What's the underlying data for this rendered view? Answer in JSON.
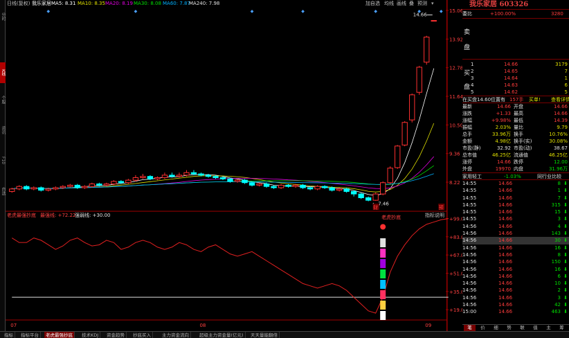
{
  "left_tabs": [
    "分时",
    "K线",
    "个股",
    "资讯",
    "F10",
    "自选"
  ],
  "main_header": {
    "period": "日线(复权)",
    "stock_name": "我乐家居",
    "ma": [
      {
        "label": "MA5: 8.31",
        "color": "#ffffff"
      },
      {
        "label": "MA10: 8.35",
        "color": "#e0e000"
      },
      {
        "label": "MA20: 8.19",
        "color": "#e000e0"
      },
      {
        "label": "MA30: 8.08",
        "color": "#00e000"
      },
      {
        "label": "MA60: 7.87",
        "color": "#00b0ff"
      },
      {
        "label": "MA240: 7.98",
        "color": "#e0e0e0"
      }
    ],
    "buttons": [
      "加自选",
      "均线",
      "画线",
      "叠",
      "预测"
    ]
  },
  "price_axis": [
    "15.06",
    "13.92",
    "12.78",
    "11.64",
    "10.50",
    "9.36",
    "8.22"
  ],
  "price_notes": {
    "high": "14.66",
    "low": "7.46"
  },
  "markers": [
    "财",
    "预"
  ],
  "sub_header": {
    "name": "老虎最强抄底",
    "value1": "最强线: +72.22",
    "value2": "强弱线: +30.00",
    "help": "指标说明"
  },
  "sub_axis": [
    "+99.09",
    "+83.08",
    "+67.07",
    "+51.05",
    "+35.03",
    "+19.02"
  ],
  "sub_annotation": "老虎抄底",
  "months": [
    "07",
    "08",
    "09"
  ],
  "chart_data": [
    {
      "type": "candlestick",
      "title": "我乐家居 日线(复权)",
      "ylim": [
        7.2,
        15.2
      ],
      "candles": [
        {
          "o": 7.85,
          "c": 7.95,
          "h": 8.0,
          "l": 7.8
        },
        {
          "o": 7.95,
          "c": 8.05,
          "h": 8.1,
          "l": 7.9
        },
        {
          "o": 8.05,
          "c": 7.95,
          "h": 8.1,
          "l": 7.9
        },
        {
          "o": 7.95,
          "c": 8.0,
          "h": 8.05,
          "l": 7.9
        },
        {
          "o": 8.0,
          "c": 7.9,
          "h": 8.05,
          "l": 7.85
        },
        {
          "o": 7.9,
          "c": 7.95,
          "h": 8.0,
          "l": 7.85
        },
        {
          "o": 7.95,
          "c": 8.0,
          "h": 8.05,
          "l": 7.9
        },
        {
          "o": 8.0,
          "c": 8.05,
          "h": 8.1,
          "l": 7.95
        },
        {
          "o": 8.05,
          "c": 8.1,
          "h": 8.15,
          "l": 8.0
        },
        {
          "o": 8.1,
          "c": 8.0,
          "h": 8.15,
          "l": 7.95
        },
        {
          "o": 8.0,
          "c": 8.05,
          "h": 8.1,
          "l": 7.95
        },
        {
          "o": 8.05,
          "c": 8.15,
          "h": 8.2,
          "l": 8.0
        },
        {
          "o": 8.15,
          "c": 8.1,
          "h": 8.2,
          "l": 8.05
        },
        {
          "o": 8.1,
          "c": 8.15,
          "h": 8.2,
          "l": 8.05
        },
        {
          "o": 8.15,
          "c": 8.25,
          "h": 8.3,
          "l": 8.1
        },
        {
          "o": 8.25,
          "c": 8.2,
          "h": 8.3,
          "l": 8.15
        },
        {
          "o": 8.2,
          "c": 8.3,
          "h": 8.35,
          "l": 8.15
        },
        {
          "o": 8.3,
          "c": 8.4,
          "h": 8.5,
          "l": 8.25
        },
        {
          "o": 8.4,
          "c": 8.45,
          "h": 8.55,
          "l": 8.35
        },
        {
          "o": 8.45,
          "c": 8.35,
          "h": 8.5,
          "l": 8.3
        },
        {
          "o": 8.35,
          "c": 8.4,
          "h": 8.45,
          "l": 8.3
        },
        {
          "o": 8.4,
          "c": 8.5,
          "h": 8.6,
          "l": 8.35
        },
        {
          "o": 8.5,
          "c": 8.45,
          "h": 8.6,
          "l": 8.4
        },
        {
          "o": 8.45,
          "c": 8.5,
          "h": 8.6,
          "l": 8.4
        },
        {
          "o": 8.5,
          "c": 8.6,
          "h": 8.7,
          "l": 8.45
        },
        {
          "o": 8.6,
          "c": 8.55,
          "h": 8.7,
          "l": 8.5
        },
        {
          "o": 8.55,
          "c": 8.5,
          "h": 8.6,
          "l": 8.45
        },
        {
          "o": 8.5,
          "c": 8.45,
          "h": 8.55,
          "l": 8.4
        },
        {
          "o": 8.45,
          "c": 8.4,
          "h": 8.5,
          "l": 8.35
        },
        {
          "o": 8.4,
          "c": 8.35,
          "h": 8.45,
          "l": 8.3
        },
        {
          "o": 8.35,
          "c": 8.25,
          "h": 8.4,
          "l": 8.2
        },
        {
          "o": 8.25,
          "c": 8.3,
          "h": 8.35,
          "l": 8.2
        },
        {
          "o": 8.3,
          "c": 8.2,
          "h": 8.35,
          "l": 8.15
        },
        {
          "o": 8.2,
          "c": 8.1,
          "h": 8.25,
          "l": 8.05
        },
        {
          "o": 8.1,
          "c": 8.15,
          "h": 8.2,
          "l": 8.05
        },
        {
          "o": 8.15,
          "c": 8.05,
          "h": 8.2,
          "l": 8.0
        },
        {
          "o": 8.05,
          "c": 8.0,
          "h": 8.1,
          "l": 7.95
        },
        {
          "o": 8.0,
          "c": 8.1,
          "h": 8.15,
          "l": 7.95
        },
        {
          "o": 8.1,
          "c": 8.05,
          "h": 8.15,
          "l": 8.0
        },
        {
          "o": 8.05,
          "c": 8.1,
          "h": 8.15,
          "l": 8.0
        },
        {
          "o": 8.1,
          "c": 8.0,
          "h": 8.15,
          "l": 7.95
        },
        {
          "o": 8.0,
          "c": 7.95,
          "h": 8.05,
          "l": 7.9
        },
        {
          "o": 7.95,
          "c": 8.05,
          "h": 8.1,
          "l": 7.9
        },
        {
          "o": 8.05,
          "c": 8.0,
          "h": 8.1,
          "l": 7.95
        },
        {
          "o": 8.0,
          "c": 7.9,
          "h": 8.05,
          "l": 7.85
        },
        {
          "o": 7.9,
          "c": 7.95,
          "h": 8.0,
          "l": 7.85
        },
        {
          "o": 7.95,
          "c": 7.85,
          "h": 8.0,
          "l": 7.8
        },
        {
          "o": 7.85,
          "c": 7.75,
          "h": 7.9,
          "l": 7.65
        },
        {
          "o": 7.75,
          "c": 7.6,
          "h": 7.8,
          "l": 7.55
        },
        {
          "o": 7.6,
          "c": 7.5,
          "h": 7.65,
          "l": 7.46
        },
        {
          "o": 7.5,
          "c": 7.75,
          "h": 7.8,
          "l": 7.48
        },
        {
          "o": 7.75,
          "c": 8.2,
          "h": 8.25,
          "l": 7.7
        },
        {
          "o": 8.2,
          "c": 8.78,
          "h": 8.85,
          "l": 8.15
        },
        {
          "o": 8.8,
          "c": 9.66,
          "h": 9.7,
          "l": 8.75
        },
        {
          "o": 9.7,
          "c": 10.6,
          "h": 10.65,
          "l": 9.65
        },
        {
          "o": 10.7,
          "c": 11.7,
          "h": 11.75,
          "l": 10.6
        },
        {
          "o": 11.8,
          "c": 12.8,
          "h": 12.85,
          "l": 11.7
        },
        {
          "o": 13.0,
          "c": 14.0,
          "h": 14.05,
          "l": 12.9
        },
        {
          "o": 14.66,
          "c": 14.66,
          "h": 14.66,
          "l": 14.66
        }
      ]
    },
    {
      "type": "line",
      "title": "老虎最强抄底",
      "ylim": [
        10,
        100
      ],
      "series": [
        {
          "name": "最强线",
          "values": [
            82,
            78,
            78,
            82,
            80,
            76,
            72,
            75,
            80,
            82,
            78,
            75,
            76,
            80,
            78,
            72,
            74,
            78,
            80,
            78,
            74,
            72,
            74,
            78,
            76,
            72,
            70,
            74,
            76,
            72,
            68,
            66,
            68,
            70,
            66,
            62,
            58,
            54,
            50,
            46,
            42,
            40,
            38,
            40,
            42,
            40,
            36,
            30,
            24,
            18,
            16,
            30,
            52,
            66,
            76,
            84,
            90,
            94,
            96,
            98,
            99
          ]
        },
        {
          "name": "强弱线",
          "values": [
            30,
            30,
            30,
            30,
            30,
            30,
            30,
            30,
            30,
            30,
            30,
            30,
            30,
            30,
            30,
            30,
            30,
            30,
            30,
            30,
            30,
            30,
            30,
            30,
            30,
            30,
            30,
            30,
            30,
            30,
            30,
            30,
            30,
            30,
            30,
            30,
            30,
            30,
            30,
            30,
            30,
            30,
            30,
            30,
            30,
            30,
            30,
            30,
            30,
            30,
            30,
            30,
            30,
            30,
            30,
            30,
            30,
            30,
            30,
            30,
            30
          ]
        }
      ]
    }
  ],
  "right_panel": {
    "title": "我乐家居 603326",
    "weibi": {
      "label": "委比",
      "value": "+100.00%",
      "diff": "3280"
    },
    "sell_labels": [
      "卖",
      "盘"
    ],
    "buy_labels": [
      "买",
      "盘"
    ],
    "buy_rows": [
      {
        "idx": "1",
        "price": "14.66",
        "vol": "3179"
      },
      {
        "idx": "2",
        "price": "14.65",
        "vol": "7"
      },
      {
        "idx": "3",
        "price": "14.64",
        "vol": "1"
      },
      {
        "idx": "4",
        "price": "14.63",
        "vol": "6"
      },
      {
        "idx": "5",
        "price": "14.62",
        "vol": "5"
      }
    ],
    "buy_note": {
      "text": "在买盘14.60位置有",
      "vol": "157手",
      "action": "买单!",
      "link": "查看详情"
    },
    "quote_rows": [
      {
        "l1": "最新",
        "v1": "14.66",
        "l2": "开盘",
        "v2": "14.66",
        "c1": "red",
        "c2": "red"
      },
      {
        "l1": "涨跌",
        "v1": "+1.33",
        "l2": "最高",
        "v2": "14.66",
        "c1": "red",
        "c2": "red"
      },
      {
        "l1": "涨幅",
        "v1": "+9.98%",
        "l2": "最低",
        "v2": "14.39",
        "c1": "red",
        "c2": "red"
      },
      {
        "l1": "振幅",
        "v1": "2.03%",
        "l2": "量比",
        "v2": "9.79",
        "c1": "yellow",
        "c2": "yellow"
      },
      {
        "l1": "总手",
        "v1": "33.96万",
        "l2": "换手",
        "v2": "10.76%",
        "c1": "yellow",
        "c2": "yellow"
      },
      {
        "l1": "金额",
        "v1": "4.98亿",
        "l2": "换手(实)",
        "v2": "30.08%",
        "c1": "yellow",
        "c2": "yellow"
      },
      {
        "l1": "市盈(静)",
        "v1": "32.92",
        "l2": "市盈(动)",
        "v2": "38.67",
        "c1": "white",
        "c2": "white"
      },
      {
        "l1": "总市值",
        "v1": "46.25亿",
        "l2": "流通值",
        "v2": "46.25亿",
        "c1": "yellow",
        "c2": "yellow"
      },
      {
        "l1": "涨停",
        "v1": "14.66",
        "l2": "跌停",
        "v2": "12.00",
        "c1": "red",
        "c2": "green"
      },
      {
        "l1": "外盘",
        "v1": "19970",
        "l2": "内盘",
        "v2": "31.96万",
        "c1": "red",
        "c2": "green"
      }
    ],
    "industry": {
      "name": "家用轻工",
      "pct": "-1.03%",
      "link": "同行业比较"
    },
    "trades": [
      {
        "t": "14:55",
        "p": "14.66",
        "v": "8",
        "dir": "down"
      },
      {
        "t": "14:55",
        "p": "14.66",
        "v": "1",
        "dir": "down"
      },
      {
        "t": "14:55",
        "p": "14.66",
        "v": "7",
        "dir": "down"
      },
      {
        "t": "14:55",
        "p": "14.66",
        "v": "315",
        "dir": "down"
      },
      {
        "t": "14:55",
        "p": "14.66",
        "v": "15",
        "dir": "down"
      },
      {
        "t": "14:55",
        "p": "14.66",
        "v": "3",
        "dir": "down"
      },
      {
        "t": "14:56",
        "p": "14.66",
        "v": "4",
        "dir": "down"
      },
      {
        "t": "14:56",
        "p": "14.66",
        "v": "143",
        "dir": "down"
      },
      {
        "t": "14:56",
        "p": "14.66",
        "v": "30",
        "dir": "down"
      },
      {
        "t": "14:56",
        "p": "14.66",
        "v": "16",
        "dir": "down"
      },
      {
        "t": "14:56",
        "p": "14.66",
        "v": "8",
        "dir": "down"
      },
      {
        "t": "14:56",
        "p": "14.66",
        "v": "150",
        "dir": "down"
      },
      {
        "t": "14:56",
        "p": "14.66",
        "v": "16",
        "dir": "down"
      },
      {
        "t": "14:56",
        "p": "14.66",
        "v": "6",
        "dir": "down"
      },
      {
        "t": "14:56",
        "p": "14.66",
        "v": "10",
        "dir": "down"
      },
      {
        "t": "14:56",
        "p": "14.66",
        "v": "2",
        "dir": "down"
      },
      {
        "t": "14:56",
        "p": "14.66",
        "v": "3",
        "dir": "down"
      },
      {
        "t": "14:56",
        "p": "14.66",
        "v": "42",
        "dir": "down"
      },
      {
        "t": "15:00",
        "p": "14.66",
        "v": "463",
        "dir": "down"
      }
    ],
    "footer_tabs": [
      "笔",
      "价",
      "细",
      "势",
      "联",
      "值",
      "主",
      "筹"
    ]
  },
  "bottom_tabs": [
    "指标",
    "指标平台",
    "老虎最强抄底",
    "技术KDJ",
    "资金趋势",
    "抄底买入",
    "主力资金流向",
    "超级主力资金量(亿元)",
    "天天量能翻倍"
  ]
}
